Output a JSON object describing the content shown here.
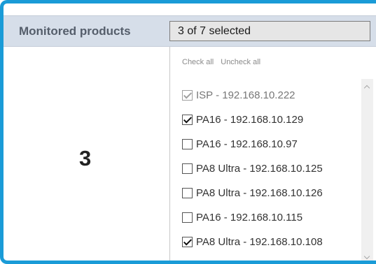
{
  "header": {
    "label": "Monitored products",
    "select_value": "3 of 7 selected"
  },
  "dropdown": {
    "check_all": "Check all",
    "uncheck_all": "Uncheck all",
    "options": [
      {
        "label": "ISP - 192.168.10.222",
        "checked": true,
        "disabled": true
      },
      {
        "label": "PA16 - 192.168.10.129",
        "checked": true,
        "disabled": false
      },
      {
        "label": "PA16 - 192.168.10.97",
        "checked": false,
        "disabled": false
      },
      {
        "label": "PA8 Ultra - 192.168.10.125",
        "checked": false,
        "disabled": false
      },
      {
        "label": "PA8 Ultra - 192.168.10.126",
        "checked": false,
        "disabled": false
      },
      {
        "label": "PA16 - 192.168.10.115",
        "checked": false,
        "disabled": false
      },
      {
        "label": "PA8 Ultra - 192.168.10.108",
        "checked": true,
        "disabled": false
      }
    ]
  },
  "annotation": {
    "step_number": "3"
  },
  "colors": {
    "frame_border": "#1a9bd7",
    "header_bg": "#d6dee9",
    "header_text": "#555e6b"
  }
}
